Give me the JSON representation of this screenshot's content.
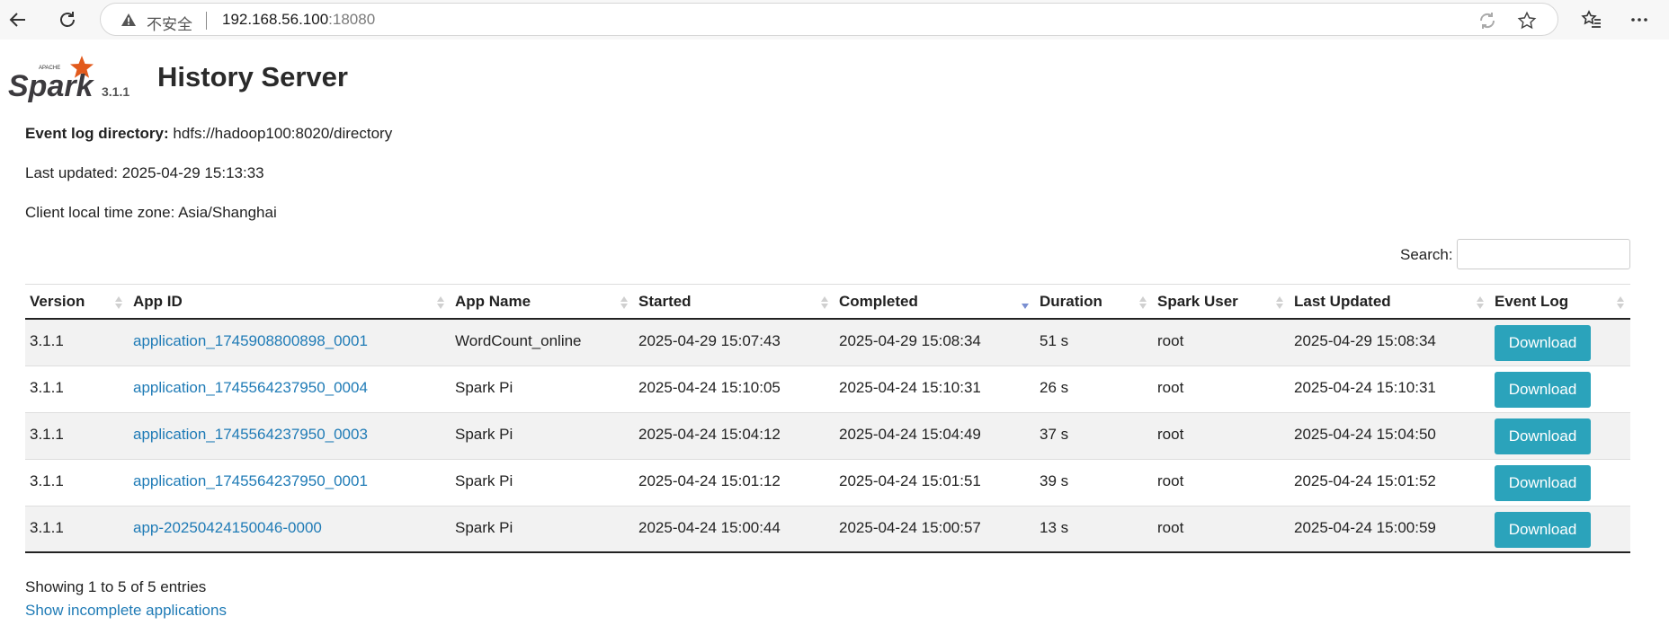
{
  "browser": {
    "insecure_label": "不安全",
    "url_host": "192.168.56.100",
    "url_port": ":18080"
  },
  "header": {
    "logo_text": "Spark",
    "logo_sub": "APACHE",
    "version": "3.1.1",
    "title": "History Server"
  },
  "info": {
    "event_log_label": "Event log directory:",
    "event_log_value": "hdfs://hadoop100:8020/directory",
    "last_updated": "Last updated: 2025-04-29 15:13:33",
    "timezone": "Client local time zone: Asia/Shanghai"
  },
  "search": {
    "label": "Search:",
    "value": ""
  },
  "table": {
    "columns": [
      "Version",
      "App ID",
      "App Name",
      "Started",
      "Completed",
      "Duration",
      "Spark User",
      "Last Updated",
      "Event Log"
    ],
    "sorted_column": "Completed",
    "sort_direction": "desc",
    "download_label": "Download",
    "rows": [
      {
        "version": "3.1.1",
        "app_id": "application_1745908800898_0001",
        "app_name": "WordCount_online",
        "started": "2025-04-29 15:07:43",
        "completed": "2025-04-29 15:08:34",
        "duration": "51 s",
        "user": "root",
        "last_updated": "2025-04-29 15:08:34"
      },
      {
        "version": "3.1.1",
        "app_id": "application_1745564237950_0004",
        "app_name": "Spark Pi",
        "started": "2025-04-24 15:10:05",
        "completed": "2025-04-24 15:10:31",
        "duration": "26 s",
        "user": "root",
        "last_updated": "2025-04-24 15:10:31"
      },
      {
        "version": "3.1.1",
        "app_id": "application_1745564237950_0003",
        "app_name": "Spark Pi",
        "started": "2025-04-24 15:04:12",
        "completed": "2025-04-24 15:04:49",
        "duration": "37 s",
        "user": "root",
        "last_updated": "2025-04-24 15:04:50"
      },
      {
        "version": "3.1.1",
        "app_id": "application_1745564237950_0001",
        "app_name": "Spark Pi",
        "started": "2025-04-24 15:01:12",
        "completed": "2025-04-24 15:01:51",
        "duration": "39 s",
        "user": "root",
        "last_updated": "2025-04-24 15:01:52"
      },
      {
        "version": "3.1.1",
        "app_id": "app-20250424150046-0000",
        "app_name": "Spark Pi",
        "started": "2025-04-24 15:00:44",
        "completed": "2025-04-24 15:00:57",
        "duration": "13 s",
        "user": "root",
        "last_updated": "2025-04-24 15:00:59"
      }
    ]
  },
  "footer": {
    "entries": "Showing 1 to 5 of 5 entries",
    "incomplete_link": "Show incomplete applications"
  },
  "colors": {
    "link": "#1f7bb6",
    "button": "#2ba3bb",
    "spark_orange": "#e25a1c"
  }
}
